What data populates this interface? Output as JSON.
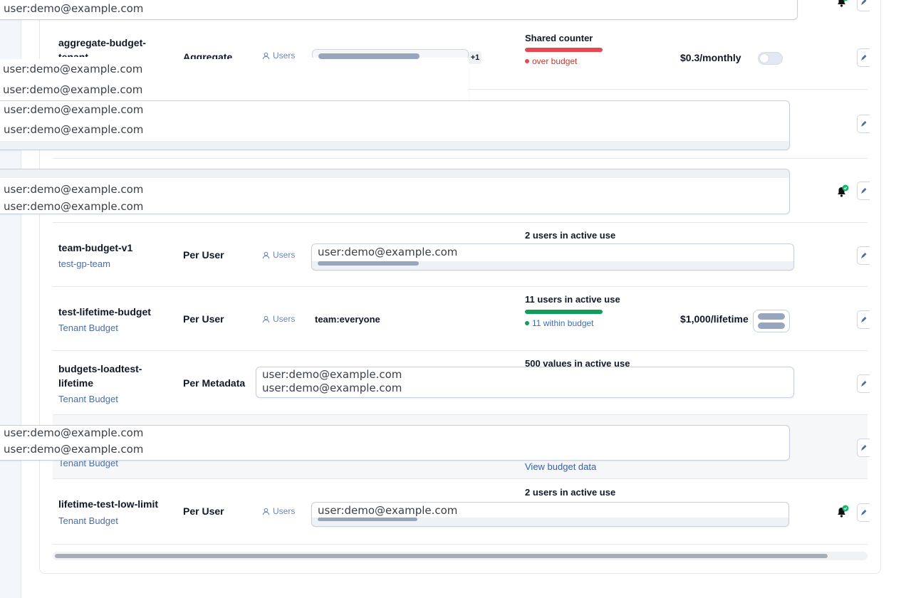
{
  "overlay_text": "user:demo@example.com",
  "rows": [
    {
      "name": "aggregate-budget-tenant",
      "type": "Aggregate",
      "users_label": "Users",
      "extra_count": "+1",
      "usage_title": "Shared counter",
      "status": "over budget",
      "status_color": "#e5484d",
      "limit": "$0.3/monthly"
    },
    {
      "name": "team-budget-v1",
      "subtitle": "test-gp-team",
      "type": "Per User",
      "users_label": "Users",
      "usage_title": "2 users in active use"
    },
    {
      "name": "test-lifetime-budget",
      "subtitle": "Tenant Budget",
      "type": "Per User",
      "users_label": "Users",
      "assignee": "team:everyone",
      "usage_title": "11 users in active use",
      "status": "11 within budget",
      "status_color": "#0f9d58",
      "limit": "$1,000/lifetime"
    },
    {
      "name": "budgets-loadtest-lifetime",
      "subtitle": "Tenant Budget",
      "type": "Per Metadata",
      "usage_title": "500 values in active use"
    },
    {
      "subtitle": "Tenant Budget",
      "link": "View budget data"
    },
    {
      "name": "lifetime-test-low-limit",
      "subtitle": "Tenant Budget",
      "type": "Per User",
      "users_label": "Users",
      "usage_title": "2 users in active use"
    }
  ],
  "colors": {
    "accent_link": "#2f5fb3",
    "over_budget": "#e5484d",
    "within_budget": "#0f9d58",
    "bell_badge": "#12b76a"
  }
}
